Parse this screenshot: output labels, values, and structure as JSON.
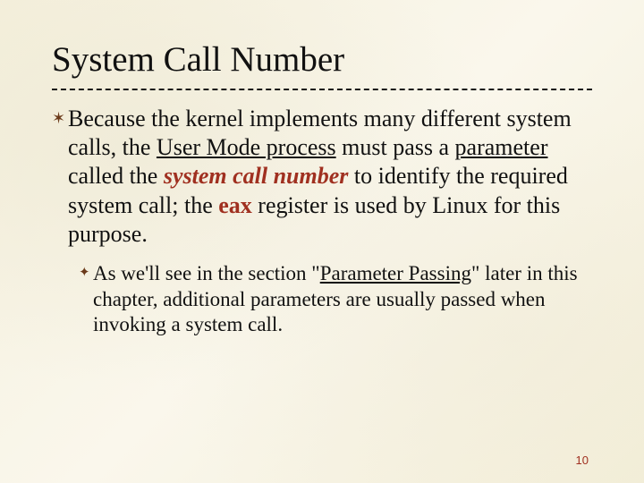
{
  "slide": {
    "title": "System Call Number",
    "page_number": "10",
    "main": {
      "t1": "Because the kernel implements many different system calls, the ",
      "u1": "User Mode process",
      "t2": " must pass a ",
      "u2": "parameter",
      "t3": " called the ",
      "em": "system call number",
      "t4": " to identify the required system call; the ",
      "bold": "eax",
      "t5": " register is used by Linux for this purpose."
    },
    "sub": {
      "t1": "As we'll see in the section \"",
      "u1": "Parameter Passing",
      "t2": "\" later in this chapter, additional parameters are usually passed when invoking a system call."
    }
  }
}
